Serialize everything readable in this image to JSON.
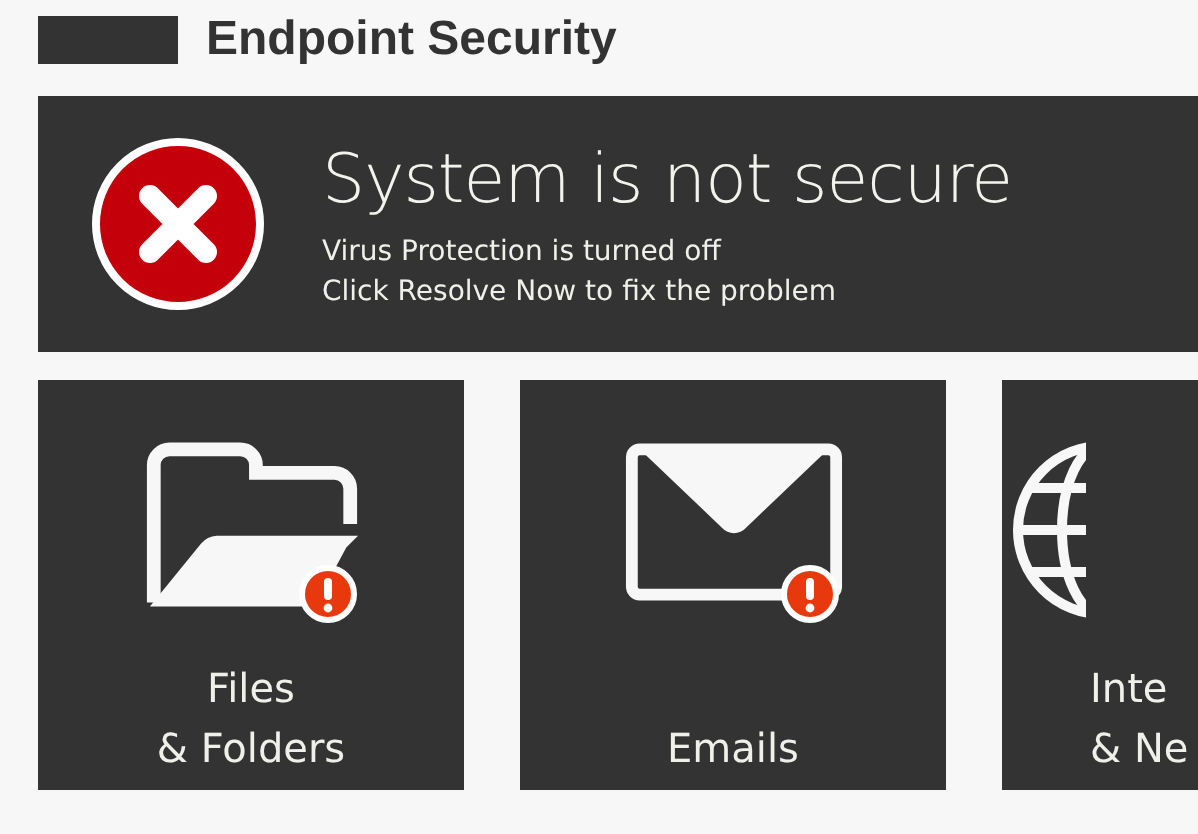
{
  "header": {
    "title": "Endpoint Security"
  },
  "status": {
    "error": true,
    "title": "System is not secure",
    "lines": [
      "Virus Protection is turned off",
      "Click Resolve Now to fix the problem"
    ]
  },
  "tiles": [
    {
      "kind": "folder",
      "label": [
        "Files",
        "& Folders"
      ],
      "alert": true,
      "cut": false
    },
    {
      "kind": "mail",
      "label": [
        "Emails"
      ],
      "alert": true,
      "cut": false
    },
    {
      "kind": "globe",
      "label": [
        "Inte",
        "& Ne"
      ],
      "alert": false,
      "cut": true
    }
  ]
}
